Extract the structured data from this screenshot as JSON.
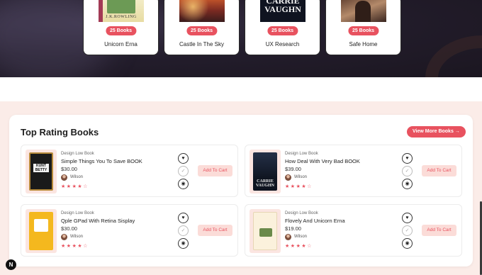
{
  "categories": [
    {
      "name": "Unicorn Erna",
      "count_label": "25 Books",
      "cover_text": "J.K.ROWLING"
    },
    {
      "name": "Castle In The Sky",
      "count_label": "25 Books",
      "cover_text": ""
    },
    {
      "name": "UX Research",
      "count_label": "25 Books",
      "cover_text": "CARRIE VAUGHN"
    },
    {
      "name": "Safe Home",
      "count_label": "25 Books",
      "cover_text": ""
    }
  ],
  "top_rating": {
    "title": "Top Rating Books",
    "view_more_label": "View More Books →",
    "add_to_cart_label": "Add To Cart",
    "books": [
      {
        "category": "Design Low Book",
        "title": "Simple Things You To Save BOOK",
        "price": "$30.00",
        "author": "Wilson",
        "rating": 4,
        "max_rating": 5,
        "cover_text": "KUNT BETTY"
      },
      {
        "category": "Design Low Book",
        "title": "How Deal With Very Bad BOOK",
        "price": "$39.00",
        "author": "Wilson",
        "rating": 4,
        "max_rating": 5,
        "cover_text": "CARRIE VAUGHN"
      },
      {
        "category": "Design Low Book",
        "title": "Qple GPad With Retina Sisplay",
        "price": "$30.00",
        "author": "Wilson",
        "rating": 4,
        "max_rating": 5,
        "cover_text": ""
      },
      {
        "category": "Design Low Book",
        "title": "Flovely And Unicorn Erna",
        "price": "$19.00",
        "author": "Wilson",
        "rating": 4,
        "max_rating": 5,
        "cover_text": ""
      }
    ]
  },
  "icons": {
    "wishlist": "heart-icon",
    "compare": "check-icon",
    "quick_view": "eye-icon",
    "dev_badge": "N"
  },
  "colors": {
    "accent": "#e8525f",
    "dark_bg": "#231d2c",
    "section_bg": "#fbece8",
    "cart_btn_bg": "#fbdcd8"
  }
}
